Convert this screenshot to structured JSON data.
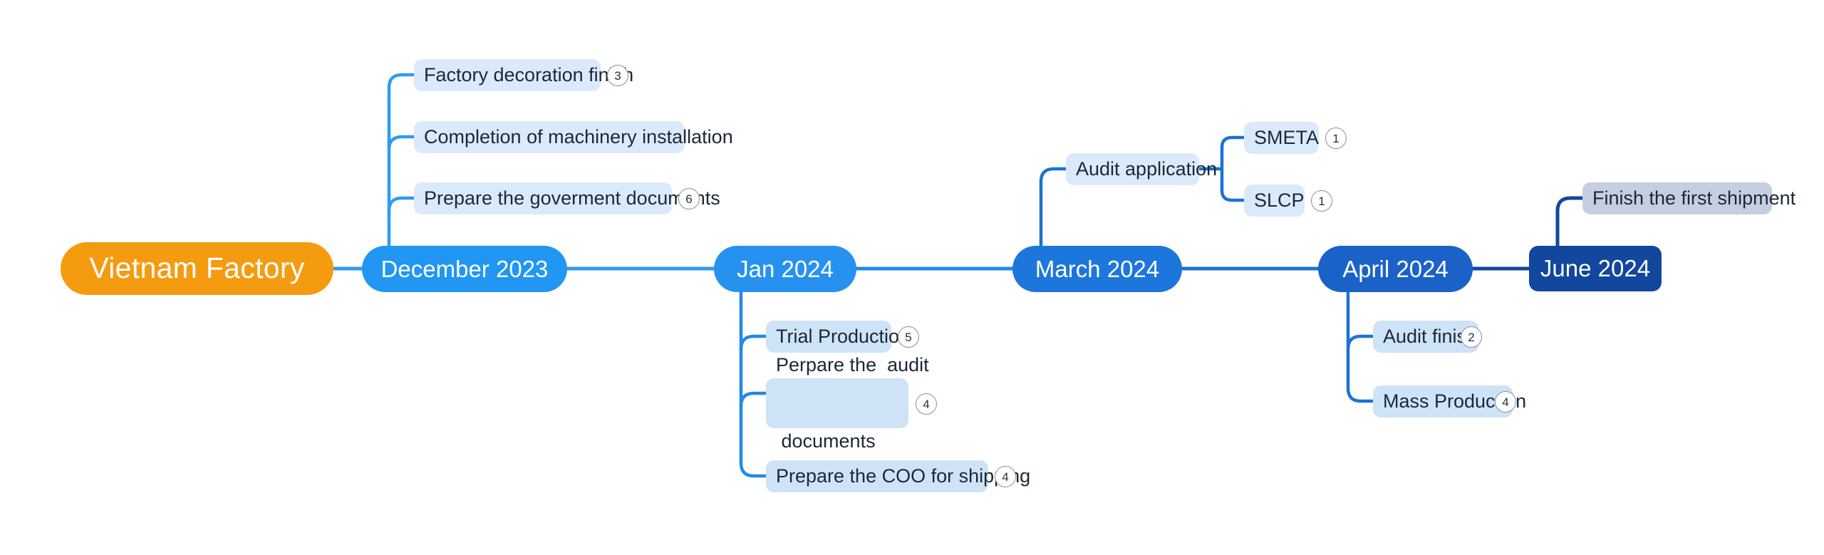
{
  "diagram": {
    "type": "mindmap-timeline",
    "title": "Vietnam Factory",
    "orientation": "left-to-right",
    "background": "#ffffff"
  },
  "colors": {
    "root": "#F59B10",
    "stage_1": "#2196F3",
    "stage_2": "#2791F0",
    "stage_3": "#1D76DC",
    "stage_4": "#1A62C8",
    "stage_5": "#12479E",
    "leaf_light": "#dbeafb",
    "leaf_mid": "#cfe3f7",
    "leaf_gray": "#c6cfe0",
    "connector_light": "#2E9BF0",
    "connector_mid": "#1C72D4",
    "connector_dark": "#12479E",
    "badge_border": "#8a8f96",
    "leaf_text": "#1b2838"
  },
  "root": {
    "label": "Vietnam Factory"
  },
  "stages": [
    {
      "id": "december-2023",
      "label": "December 2023",
      "children": [
        {
          "id": "factory-decoration-finish",
          "label": "Factory decoration finish",
          "badge": "3"
        },
        {
          "id": "completion-of-machinery-installation",
          "label": "Completion of machinery installation",
          "badge": ""
        },
        {
          "id": "prepare-the-goverment-documents",
          "label": "Prepare the goverment documents",
          "badge": "6"
        }
      ]
    },
    {
      "id": "jan-2024",
      "label": "Jan 2024",
      "children": [
        {
          "id": "trial-production",
          "label": "Trial Production",
          "badge": "5"
        },
        {
          "id": "perpare-the-audit-documents",
          "label": "Perpare the  audit",
          "label_line2": " documents",
          "badge": "4"
        },
        {
          "id": "prepare-the-coo-for-shipping",
          "label": "Prepare the COO for shipping",
          "badge": "4"
        }
      ]
    },
    {
      "id": "march-2024",
      "label": "March 2024",
      "children": [
        {
          "id": "audit-application",
          "label": "Audit application",
          "badge": "",
          "children": [
            {
              "id": "smeta",
              "label": "SMETA",
              "badge": "1"
            },
            {
              "id": "slcp",
              "label": "SLCP",
              "badge": "1"
            }
          ]
        }
      ]
    },
    {
      "id": "april-2024",
      "label": "April 2024",
      "children": [
        {
          "id": "audit-finish",
          "label": "Audit finish",
          "badge": "2"
        },
        {
          "id": "mass-production",
          "label": "Mass Production",
          "badge": "4"
        }
      ]
    },
    {
      "id": "june-2024",
      "label": "June 2024",
      "children": [
        {
          "id": "finish-the-first-shipment",
          "label": "Finish the first shipment",
          "badge": ""
        }
      ]
    }
  ]
}
